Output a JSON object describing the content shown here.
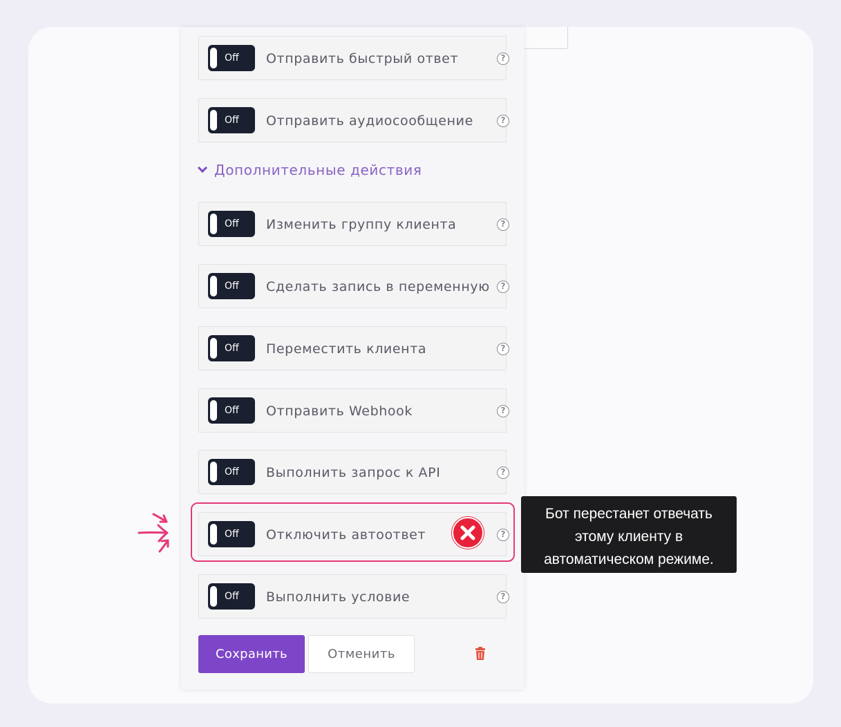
{
  "actions": [
    {
      "state": "Off",
      "label": "Отправить быстрый ответ",
      "help": "?"
    },
    {
      "state": "Off",
      "label": "Отправить аудиосообщение",
      "help": "?"
    },
    {
      "state": "Off",
      "label": "Изменить группу клиента",
      "help": "?"
    },
    {
      "state": "Off",
      "label": "Сделать запись в переменную",
      "help": "?"
    },
    {
      "state": "Off",
      "label": "Переместить клиента",
      "help": "?"
    },
    {
      "state": "Off",
      "label": "Отправить Webhook",
      "help": "?"
    },
    {
      "state": "Off",
      "label": "Выполнить запрос к API",
      "help": "?"
    },
    {
      "state": "Off",
      "label": "Отключить автоответ",
      "help": "?"
    },
    {
      "state": "Off",
      "label": "Выполнить условие",
      "help": "?"
    }
  ],
  "section": {
    "title": "Дополнительные действия"
  },
  "tooltip": {
    "lines": [
      "Бот перестанет отвечать",
      "этому клиенту в",
      "автоматическом режиме."
    ]
  },
  "buttons": {
    "save": "Сохранить",
    "cancel": "Отменить"
  },
  "colors": {
    "accent": "#7d45c8",
    "highlight": "#e6397a",
    "error": "#e8213a",
    "toggle": "#1b2030"
  }
}
